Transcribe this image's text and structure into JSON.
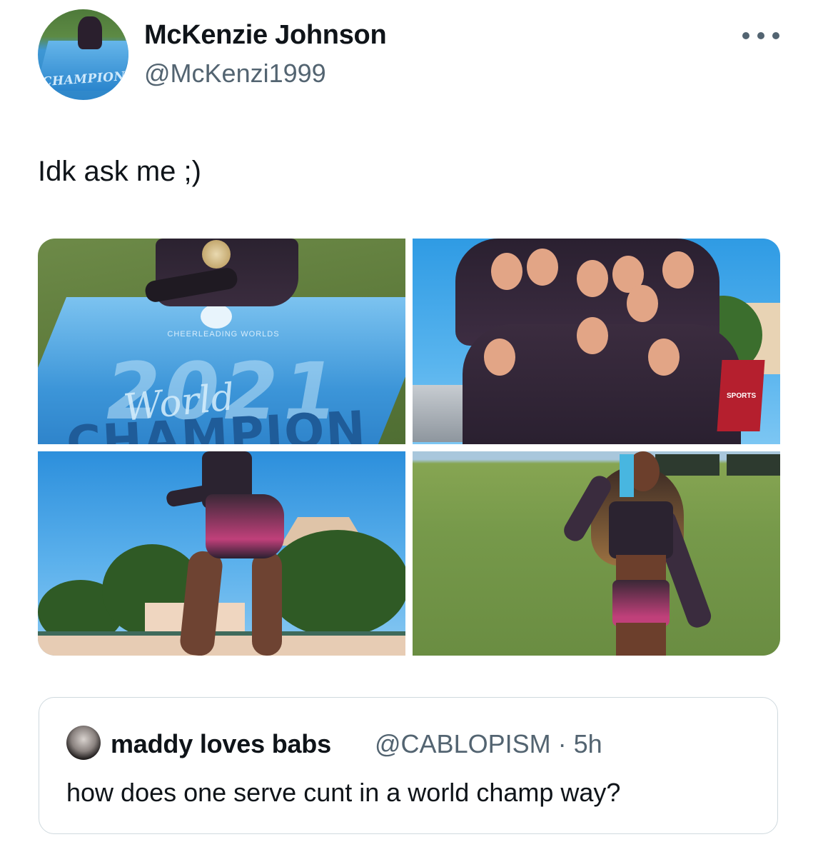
{
  "author": {
    "name": "McKenzie Johnson",
    "handle": "@McKenzi1999",
    "avatar_text": "CHAMPION"
  },
  "tweet": {
    "text": "Idk ask me ;)",
    "more_icon": "more-horizontal-icon"
  },
  "media": {
    "photo1_text": {
      "logo": "CHEERLEADING WORLDS",
      "year": "2021",
      "script": "World",
      "banner": "CHAMPION"
    },
    "photo2_sign": "SPORTS"
  },
  "quote": {
    "name": "maddy loves babs",
    "handle_time": "@CABLOPISM · 5h",
    "text": "how does one serve cunt in a world champ way?"
  },
  "colors": {
    "text_primary": "#0f1419",
    "text_secondary": "#536471",
    "border": "#cfd9de"
  }
}
